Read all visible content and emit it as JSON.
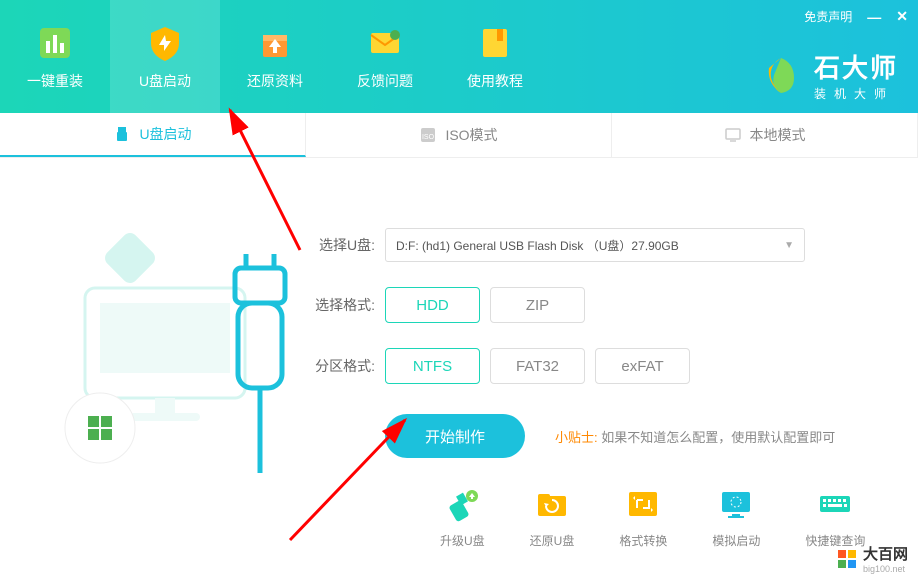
{
  "header": {
    "nav": [
      {
        "label": "一键重装",
        "id": "reinstall"
      },
      {
        "label": "U盘启动",
        "id": "usb-boot",
        "active": true
      },
      {
        "label": "还原资料",
        "id": "restore"
      },
      {
        "label": "反馈问题",
        "id": "feedback"
      },
      {
        "label": "使用教程",
        "id": "tutorial"
      }
    ],
    "disclaimer": "免责声明",
    "brand": {
      "title": "石大师",
      "sub": "装机大师"
    }
  },
  "tabs": [
    {
      "label": "U盘启动",
      "id": "usb",
      "active": true
    },
    {
      "label": "ISO模式",
      "id": "iso"
    },
    {
      "label": "本地模式",
      "id": "local"
    }
  ],
  "form": {
    "select_usb_label": "选择U盘:",
    "select_usb_value": "D:F: (hd1) General USB Flash Disk （U盘）27.90GB",
    "format_label": "选择格式:",
    "format_options": [
      {
        "label": "HDD",
        "selected": true
      },
      {
        "label": "ZIP",
        "selected": false
      }
    ],
    "partition_label": "分区格式:",
    "partition_options": [
      {
        "label": "NTFS",
        "selected": true
      },
      {
        "label": "FAT32",
        "selected": false
      },
      {
        "label": "exFAT",
        "selected": false
      }
    ],
    "start_button": "开始制作",
    "tip_label": "小贴士:",
    "tip_text": "如果不知道怎么配置，使用默认配置即可"
  },
  "tools": [
    {
      "label": "升级U盘",
      "id": "upgrade"
    },
    {
      "label": "还原U盘",
      "id": "restore-usb"
    },
    {
      "label": "格式转换",
      "id": "convert"
    },
    {
      "label": "模拟启动",
      "id": "simulate"
    },
    {
      "label": "快捷键查询",
      "id": "shortcut"
    }
  ],
  "watermark": {
    "title": "大百网",
    "url": "big100.net"
  }
}
